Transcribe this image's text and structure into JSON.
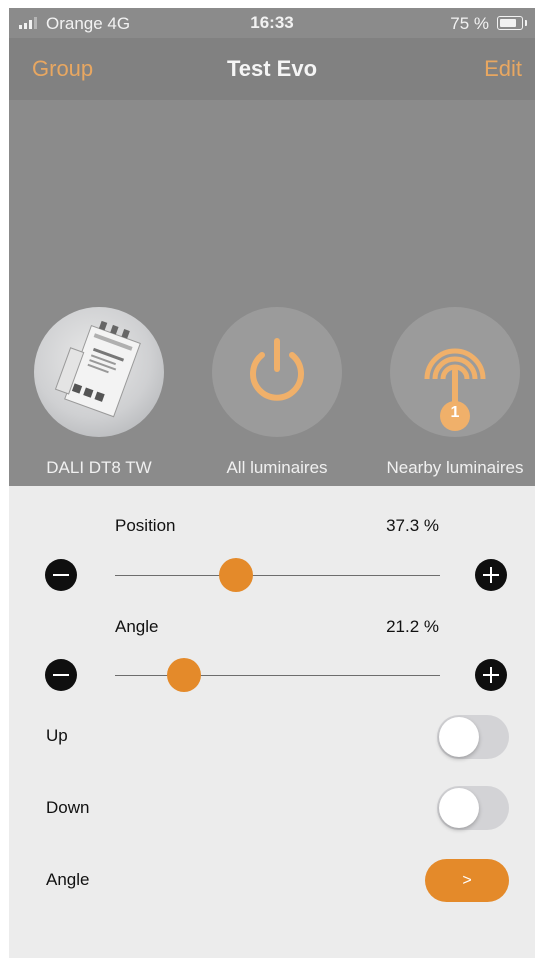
{
  "colors": {
    "accent": "#e48a2a",
    "nav_link": "#e8a761",
    "overlay": "#8b8b8b",
    "panel": "#ececec"
  },
  "status_bar": {
    "carrier": "Orange  4G",
    "time": "16:33",
    "battery": "75 %"
  },
  "nav": {
    "left": "Group",
    "title": "Test Evo",
    "right": "Edit"
  },
  "devices": [
    {
      "label": "DALI DT8 TW",
      "icon": "device-photo"
    },
    {
      "label": "All luminaires",
      "icon": "power-icon"
    },
    {
      "label": "Nearby luminaires",
      "icon": "signal-icon",
      "badge": "1"
    }
  ],
  "position": {
    "label": "Position",
    "value_text": "37.3 %",
    "value": 37.3
  },
  "angle": {
    "label": "Angle",
    "value_text": "21.2 %",
    "value": 21.2
  },
  "up": {
    "label": "Up",
    "on": false
  },
  "down": {
    "label": "Down",
    "on": false
  },
  "angle_nav": {
    "label": "Angle",
    "button": ">"
  }
}
